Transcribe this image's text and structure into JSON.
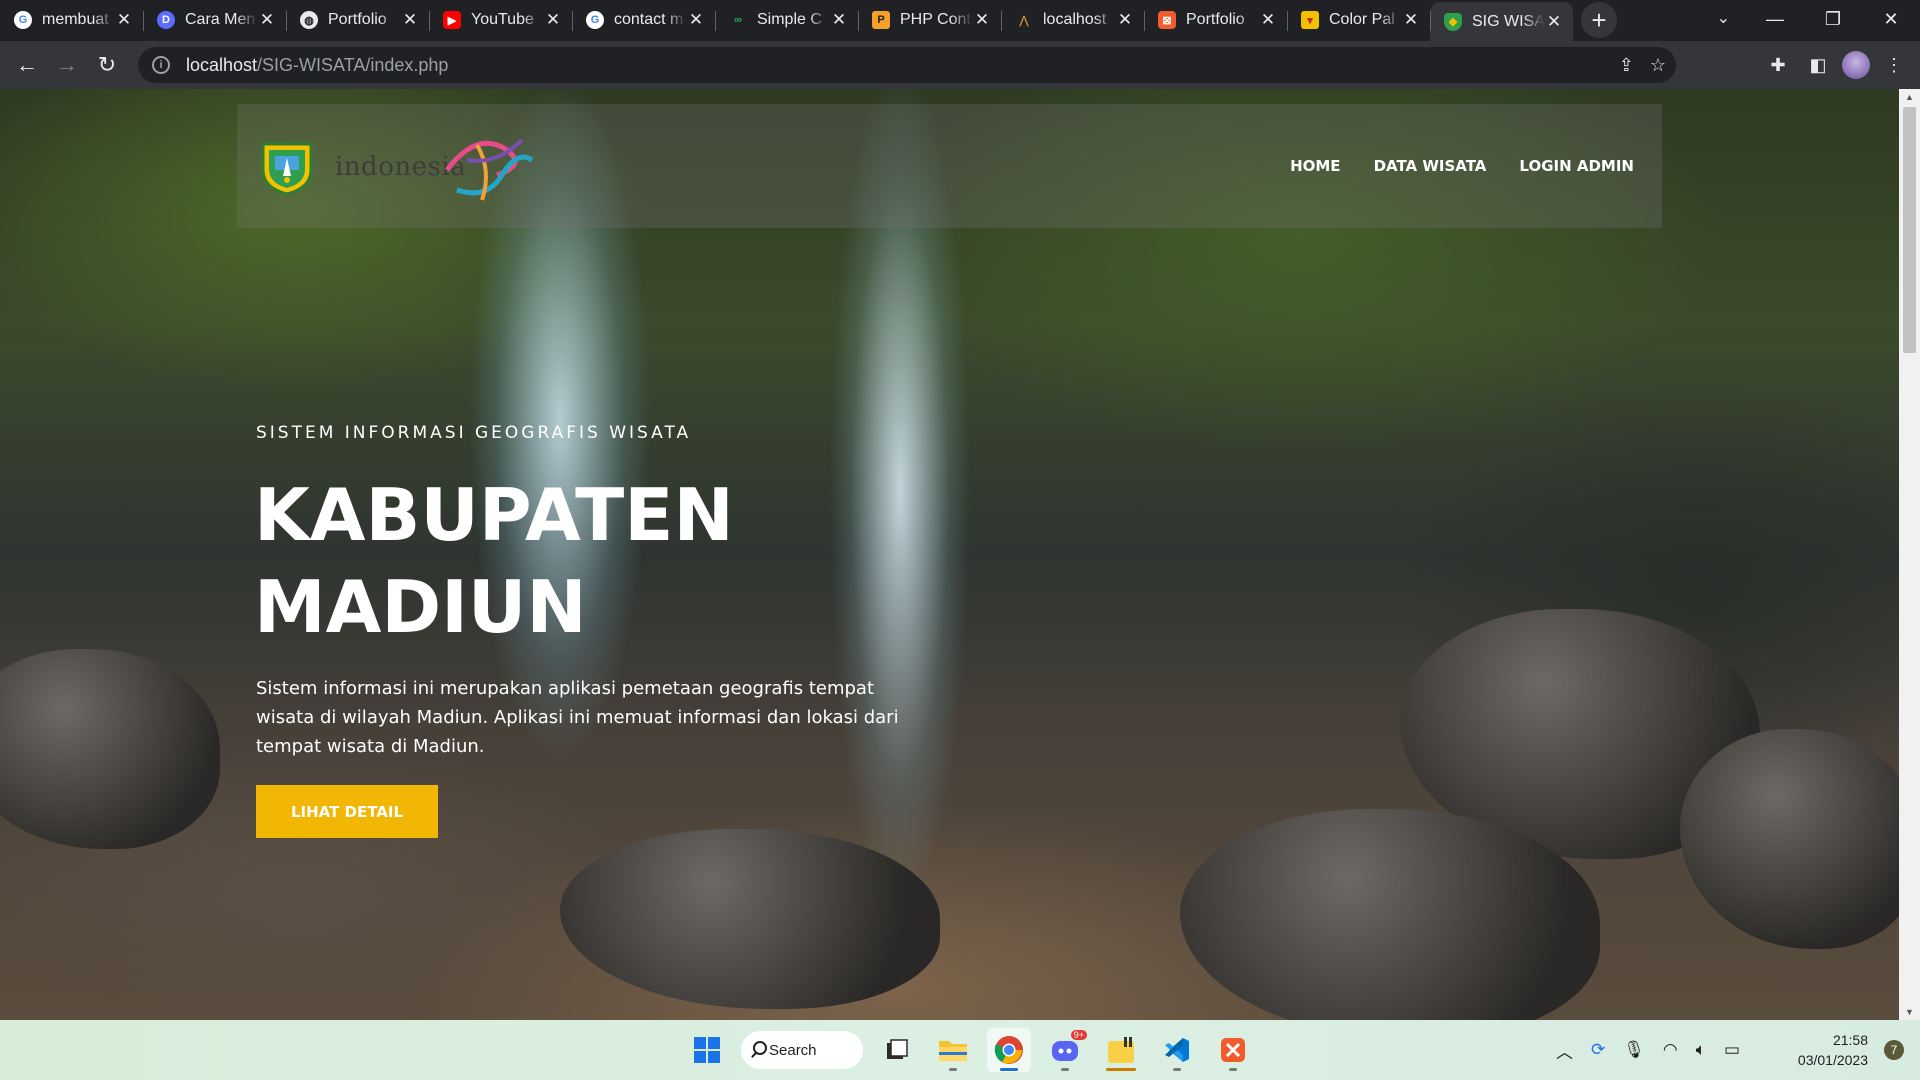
{
  "browser": {
    "tabs": [
      {
        "title": "membuat",
        "icon": "google-icon",
        "color": "#4285f4"
      },
      {
        "title": "Cara Men",
        "icon": "cara-icon",
        "color": "#5b6cff"
      },
      {
        "title": "Portfolio",
        "icon": "globe-icon",
        "color": "#e8eaed"
      },
      {
        "title": "YouTube",
        "icon": "youtube-icon",
        "color": "#ff0000"
      },
      {
        "title": "contact m",
        "icon": "google-icon",
        "color": "#4285f4"
      },
      {
        "title": "Simple C",
        "icon": "codeigniter-icon",
        "color": "#34a853"
      },
      {
        "title": "PHP Cont",
        "icon": "php-icon",
        "color": "#f4a02a"
      },
      {
        "title": "localhost",
        "icon": "xampp-icon",
        "color": "#c48a2b"
      },
      {
        "title": "Portfolio",
        "icon": "portfolio-icon",
        "color": "#f25b2b"
      },
      {
        "title": "Color Pal",
        "icon": "palette-icon",
        "color": "#f2c200"
      },
      {
        "title": "SIG WISA",
        "icon": "shield-icon",
        "color": "#2e9e4f"
      }
    ],
    "url": {
      "host": "localhost",
      "path": "/SIG-WISATA/index.php"
    }
  },
  "site": {
    "logo_text": "indonesia",
    "nav": [
      "HOME",
      "DATA WISATA",
      "LOGIN ADMIN"
    ],
    "hero": {
      "subtitle": "SISTEM INFORMASI GEOGRAFIS WISATA",
      "title_line1": "KABUPATEN",
      "title_line2": "MADIUN",
      "description": "Sistem informasi ini merupakan aplikasi pemetaan geografis tempat wisata di wilayah Madiun. Aplikasi ini memuat informasi dan lokasi dari tempat wisata di Madiun.",
      "button": "LIHAT DETAIL"
    },
    "colors": {
      "accent": "#f2b705"
    }
  },
  "taskbar": {
    "search_label": "Search",
    "time": "21:58",
    "date": "03/01/2023",
    "notifications": "7",
    "discord_badge": "9+"
  }
}
